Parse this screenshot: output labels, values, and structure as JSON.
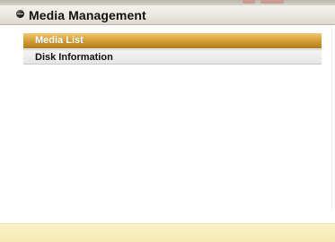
{
  "header": {
    "title": "Media Management",
    "icon": "bullet-icon"
  },
  "menu": {
    "items": [
      {
        "label": "Media List",
        "selected": true
      },
      {
        "label": "Disk Information",
        "selected": false
      }
    ]
  },
  "colors": {
    "selected_gold": "#d9a23a",
    "footer_bar": "#f7ecbb",
    "header_bg": "#ebe8e0"
  }
}
